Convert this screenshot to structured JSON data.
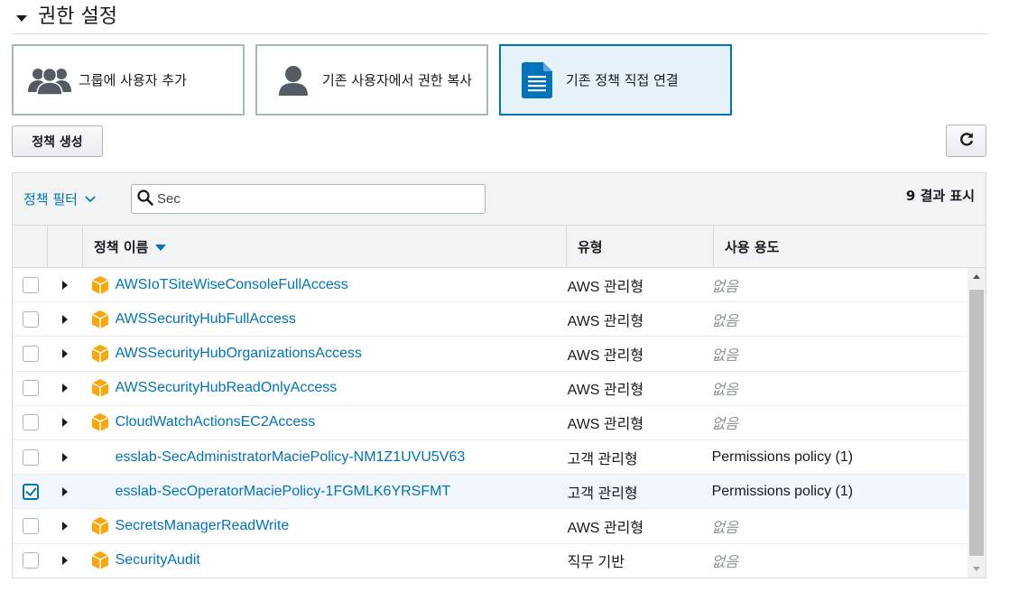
{
  "section": {
    "title": "권한 설정"
  },
  "tiles": [
    {
      "label": "그룹에 사용자 추가",
      "icon": "group-icon",
      "selected": false
    },
    {
      "label": "기존 사용자에서 권한 복사",
      "icon": "user-icon",
      "selected": false
    },
    {
      "label": "기존 정책 직접 연결",
      "icon": "document-icon",
      "selected": true
    }
  ],
  "toolbar": {
    "create_policy_label": "정책 생성",
    "refresh_icon": "refresh-icon"
  },
  "filter": {
    "label": "정책 필터",
    "search_value": "Sec",
    "result_count": "9 결과 표시"
  },
  "columns": {
    "name": "정책 이름",
    "type": "유형",
    "usage": "사용 용도"
  },
  "rows": [
    {
      "name": "AWSIoTSiteWiseConsoleFullAccess",
      "type": "AWS 관리형",
      "usage": "없음",
      "aws_icon": true,
      "checked": false
    },
    {
      "name": "AWSSecurityHubFullAccess",
      "type": "AWS 관리형",
      "usage": "없음",
      "aws_icon": true,
      "checked": false
    },
    {
      "name": "AWSSecurityHubOrganizationsAccess",
      "type": "AWS 관리형",
      "usage": "없음",
      "aws_icon": true,
      "checked": false
    },
    {
      "name": "AWSSecurityHubReadOnlyAccess",
      "type": "AWS 관리형",
      "usage": "없음",
      "aws_icon": true,
      "checked": false
    },
    {
      "name": "CloudWatchActionsEC2Access",
      "type": "AWS 관리형",
      "usage": "없음",
      "aws_icon": true,
      "checked": false
    },
    {
      "name": "esslab-SecAdministratorMaciePolicy-NM1Z1UVU5V63",
      "type": "고객 관리형",
      "usage": "Permissions policy (1)",
      "aws_icon": false,
      "checked": false
    },
    {
      "name": "esslab-SecOperatorMaciePolicy-1FGMLK6YRSFMT",
      "type": "고객 관리형",
      "usage": "Permissions policy (1)",
      "aws_icon": false,
      "checked": true
    },
    {
      "name": "SecretsManagerReadWrite",
      "type": "AWS 관리형",
      "usage": "없음",
      "aws_icon": true,
      "checked": false
    },
    {
      "name": "SecurityAudit",
      "type": "직무 기반",
      "usage": "없음",
      "aws_icon": true,
      "checked": false
    }
  ],
  "colors": {
    "accent": "#0073bb",
    "selected_tile_bg": "#e7f3fb",
    "aws_icon": "#f7a80d",
    "muted": "#879596"
  }
}
